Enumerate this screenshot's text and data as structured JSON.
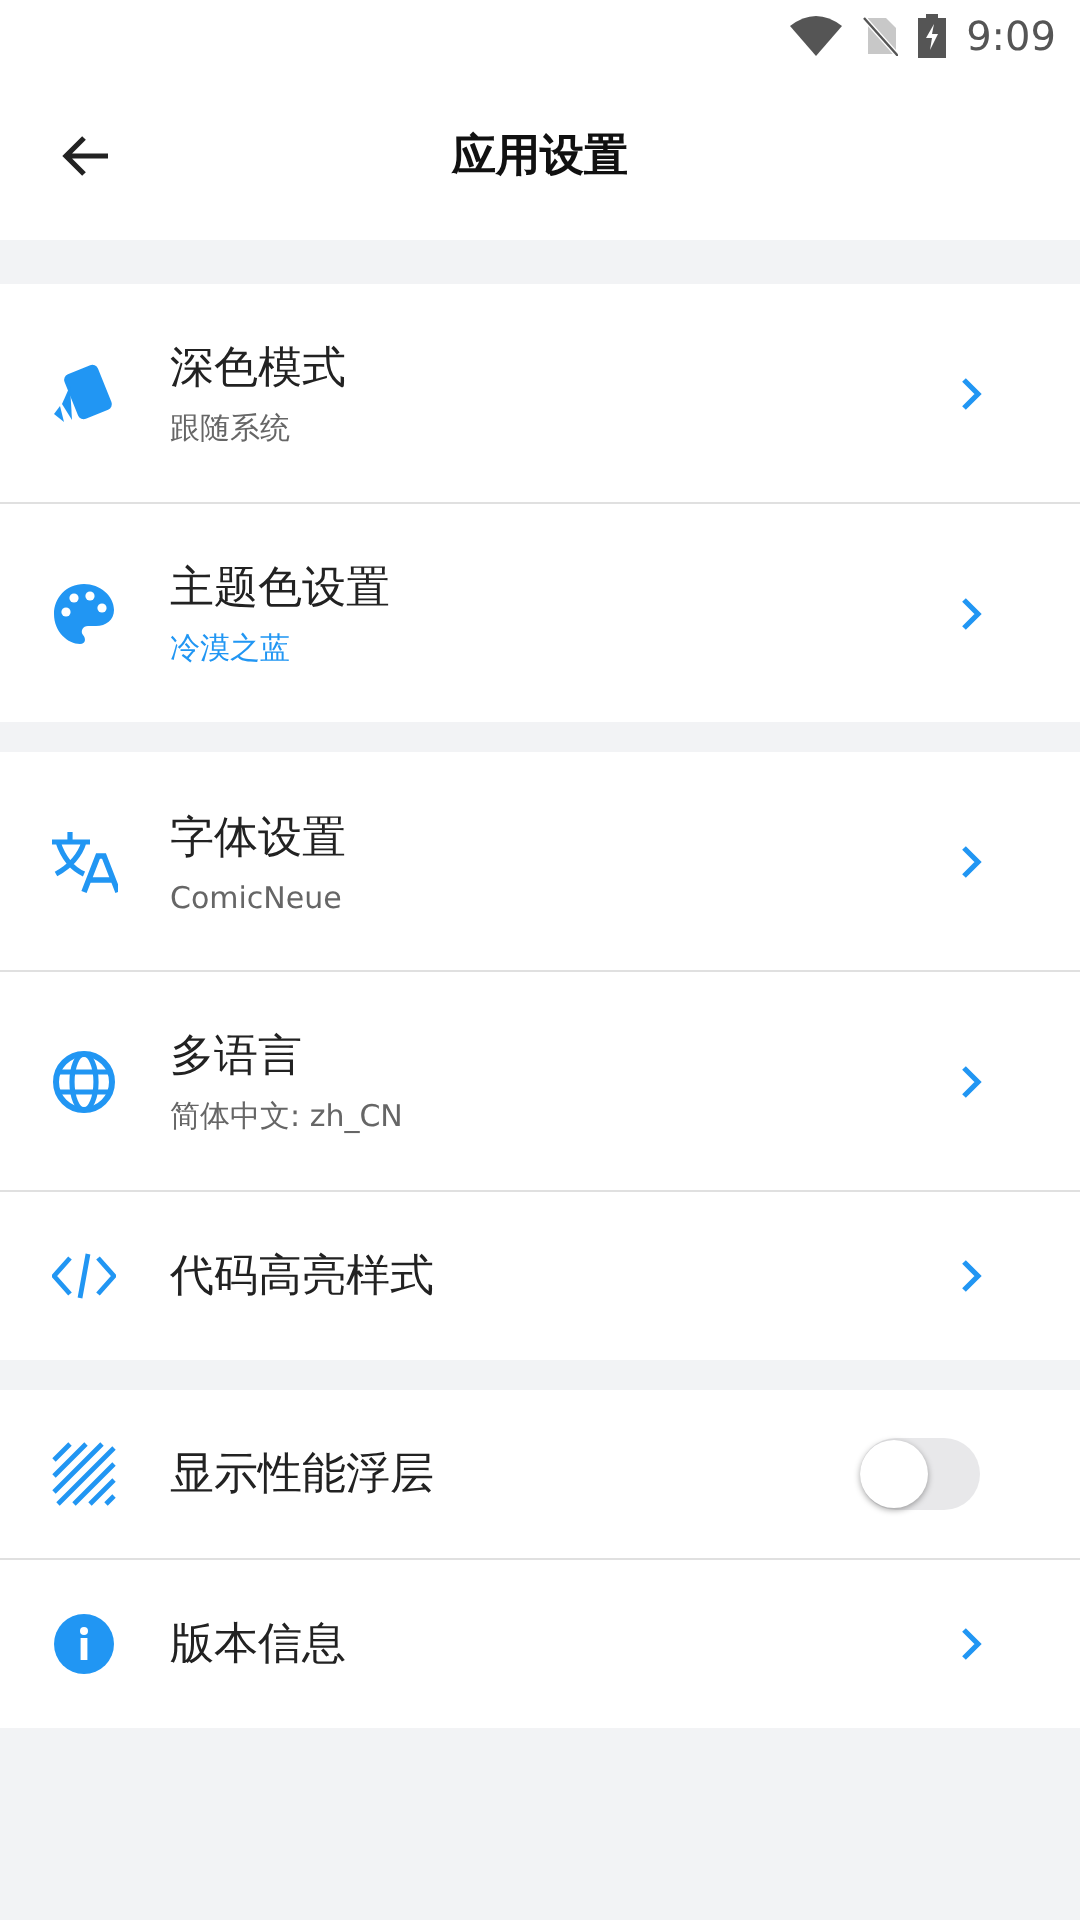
{
  "status_bar": {
    "time": "9:09"
  },
  "header": {
    "title": "应用设置"
  },
  "groups": [
    {
      "rows": [
        {
          "kind": "link",
          "label": "深色模式",
          "subtitle": "跟随系统",
          "subtitle_accent": false
        },
        {
          "kind": "link",
          "label": "主题色设置",
          "subtitle": "冷漠之蓝",
          "subtitle_accent": true
        }
      ]
    },
    {
      "rows": [
        {
          "kind": "link",
          "label": "字体设置",
          "subtitle": "ComicNeue",
          "subtitle_accent": false
        },
        {
          "kind": "link",
          "label": "多语言",
          "subtitle": "简体中文: zh_CN",
          "subtitle_accent": false
        },
        {
          "kind": "link",
          "label": "代码高亮样式"
        }
      ]
    },
    {
      "rows": [
        {
          "kind": "toggle",
          "label": "显示性能浮层",
          "on": false
        },
        {
          "kind": "link",
          "label": "版本信息"
        }
      ]
    }
  ]
}
